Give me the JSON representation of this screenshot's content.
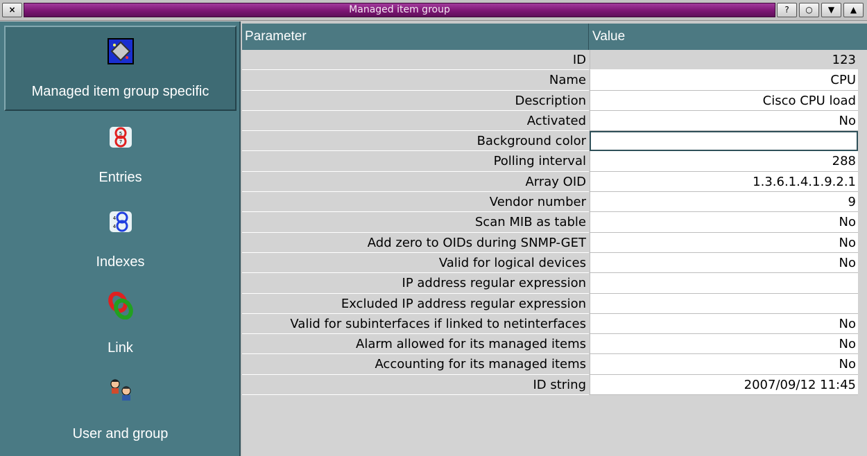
{
  "window": {
    "title": "Managed item group",
    "close_label": "×",
    "help_label": "?",
    "restore_label": "○",
    "minimize_label": "▼",
    "maximize_label": "▲"
  },
  "colors": {
    "title_bar": "#7c1674",
    "sidebar_bg": "#4a7a84",
    "header_bg": "#4c7982",
    "param_cell": "#d3d3d3",
    "value_cell": "#ffffff"
  },
  "sidebar": {
    "items": [
      {
        "label": "Managed item group specific",
        "icon": "managed-item-group-icon",
        "selected": true
      },
      {
        "label": "Entries",
        "icon": "entries-icon"
      },
      {
        "label": "Indexes",
        "icon": "indexes-icon"
      },
      {
        "label": "Link",
        "icon": "link-icon"
      },
      {
        "label": "User and group",
        "icon": "users-icon"
      }
    ]
  },
  "table": {
    "headers": {
      "parameter": "Parameter",
      "value": "Value"
    },
    "rows": [
      {
        "param": "ID",
        "value": "123"
      },
      {
        "param": "Name",
        "value": "CPU"
      },
      {
        "param": "Description",
        "value": "Cisco CPU load"
      },
      {
        "param": "Activated",
        "value": "No"
      },
      {
        "param": "Background color",
        "value": ""
      },
      {
        "param": "Polling interval",
        "value": "288"
      },
      {
        "param": "Array OID",
        "value": "1.3.6.1.4.1.9.2.1"
      },
      {
        "param": "Vendor number",
        "value": "9"
      },
      {
        "param": "Scan MIB as table",
        "value": "No"
      },
      {
        "param": "Add zero to OIDs during SNMP-GET",
        "value": "No"
      },
      {
        "param": "Valid for logical devices",
        "value": "No"
      },
      {
        "param": "IP address regular expression",
        "value": ""
      },
      {
        "param": "Excluded IP address regular expression",
        "value": ""
      },
      {
        "param": "Valid for subinterfaces if linked to netinterfaces",
        "value": "No"
      },
      {
        "param": "Alarm allowed for its managed items",
        "value": "No"
      },
      {
        "param": "Accounting for its managed items",
        "value": "No"
      },
      {
        "param": "ID string",
        "value": "2007/09/12 11:45"
      }
    ]
  }
}
